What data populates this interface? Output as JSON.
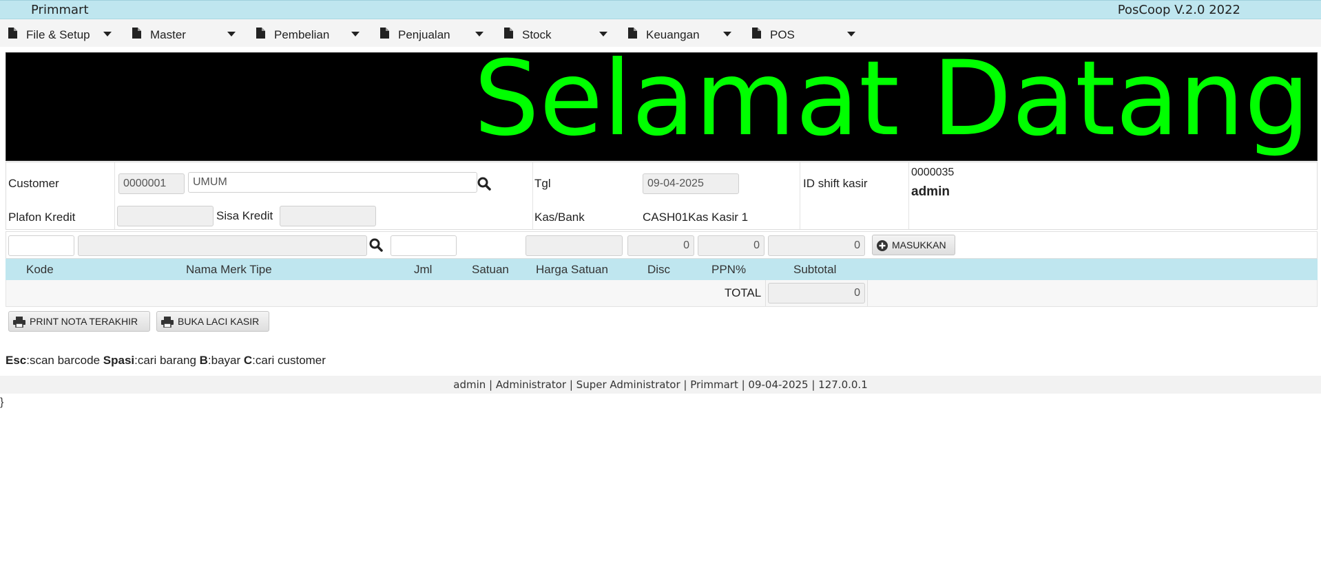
{
  "header": {
    "app_name": "Primmart",
    "version": "PosCoop V.2.0 2022"
  },
  "menu": [
    {
      "label": "File & Setup"
    },
    {
      "label": "Master"
    },
    {
      "label": "Pembelian"
    },
    {
      "label": "Penjualan"
    },
    {
      "label": "Stock"
    },
    {
      "label": "Keuangan"
    },
    {
      "label": "POS"
    }
  ],
  "banner": {
    "text": "Selamat Datang",
    "color": "#00ff00"
  },
  "form": {
    "customer_label": "Customer",
    "customer_code": "0000001",
    "customer_name": "UMUM",
    "tgl_label": "Tgl",
    "tgl_value": "09-04-2025",
    "shift_label": "ID shift kasir",
    "shift_id": "0000035",
    "shift_user": "admin",
    "plafon_label": "Plafon Kredit",
    "plafon_value": "",
    "sisa_label": "Sisa Kredit",
    "sisa_value": "",
    "kas_label": "Kas/Bank",
    "kas_value": "CASH01Kas Kasir 1"
  },
  "entry": {
    "kode": "",
    "nama": "",
    "jml": "",
    "harga": "",
    "disc": "0",
    "ppn": "0",
    "subtotal": "0",
    "add_button": "MASUKKAN"
  },
  "table": {
    "columns": [
      "Kode",
      "Nama Merk Tipe",
      "Jml",
      "Satuan",
      "Harga Satuan",
      "Disc",
      "PPN%",
      "Subtotal"
    ],
    "total_label": "TOTAL",
    "total_value": "0"
  },
  "actions": {
    "print_last": "PRINT NOTA TERAKHIR",
    "open_drawer": "BUKA LACI KASIR"
  },
  "shortcuts": [
    {
      "key": "Esc",
      "desc": ":scan barcode "
    },
    {
      "key": "Spasi",
      "desc": ":cari barang "
    },
    {
      "key": "B",
      "desc": ":bayar "
    },
    {
      "key": "C",
      "desc": ":cari customer"
    }
  ],
  "footer": {
    "text": "admin | Administrator | Super Administrator | Primmart | 09-04-2025 | 127.0.0.1"
  },
  "trailing_text": "}"
}
